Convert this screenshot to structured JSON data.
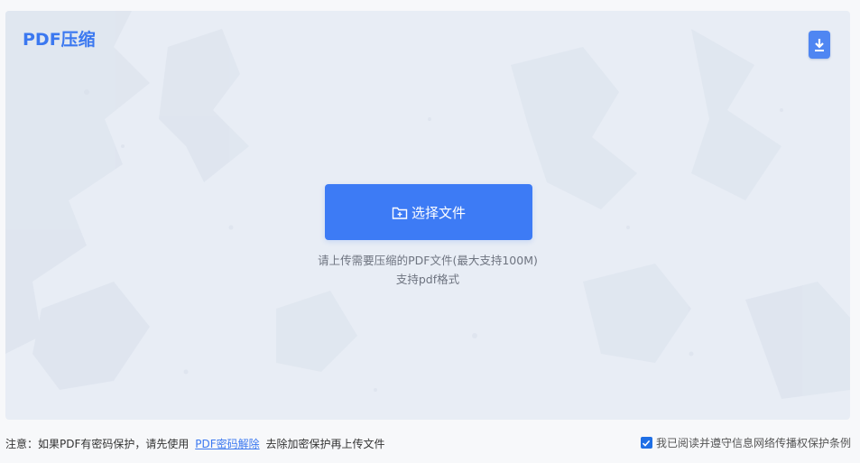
{
  "header": {
    "title": "PDF压缩"
  },
  "upload": {
    "button_label": "选择文件",
    "hint_line1": "请上传需要压缩的PDF文件(最大支持100M)",
    "hint_line2": "支持pdf格式"
  },
  "footer": {
    "notice_prefix": "注意：如果PDF有密码保护，请先使用",
    "notice_link": "PDF密码解除",
    "notice_suffix": "去除加密保护再上传文件",
    "agreement_checked": true,
    "agreement_label": "我已阅读并遵守信息网络传播权保护条例"
  },
  "icons": {
    "download": "download-icon",
    "folder": "folder-upload-icon",
    "checkbox": "checkbox-checked-icon"
  },
  "colors": {
    "accent": "#3d7bf5",
    "panel_bg": "#e8edf5",
    "link": "#3b78f0"
  }
}
